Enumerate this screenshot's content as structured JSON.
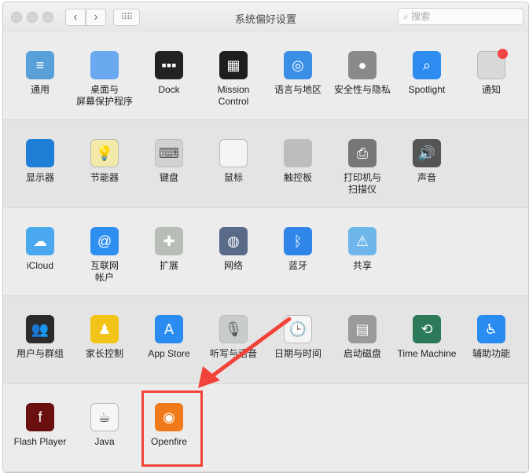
{
  "window": {
    "title": "系统偏好设置",
    "search_placeholder": "搜索",
    "back_icon": "chevron-left-icon",
    "forward_icon": "chevron-right-icon",
    "grid_icon": "show-all-grid-icon"
  },
  "rows": [
    [
      {
        "id": "general",
        "label": "通用",
        "icon": "general-icon",
        "color": "#5aa0d8",
        "glyph": "≡"
      },
      {
        "id": "desktop",
        "label": "桌面与\n屏幕保护程序",
        "icon": "desktop-icon",
        "color": "#6aa8f0",
        "glyph": ""
      },
      {
        "id": "dock",
        "label": "Dock",
        "icon": "dock-icon",
        "color": "#222222",
        "glyph": "▪▪▪"
      },
      {
        "id": "mission-control",
        "label": "Mission\nControl",
        "icon": "mission-control-icon",
        "color": "#1e1e1e",
        "glyph": "▦"
      },
      {
        "id": "language",
        "label": "语言与地区",
        "icon": "un-flag-icon",
        "color": "#3a8ee6",
        "glyph": "◎"
      },
      {
        "id": "security",
        "label": "安全性与隐私",
        "icon": "security-house-icon",
        "color": "#8a8a8a",
        "glyph": "●"
      },
      {
        "id": "spotlight",
        "label": "Spotlight",
        "icon": "spotlight-icon",
        "color": "#2e8cf0",
        "glyph": "⌕"
      },
      {
        "id": "notifications",
        "label": "通知",
        "icon": "notifications-icon",
        "color": "#d8d8d8",
        "glyph": ""
      }
    ],
    [
      {
        "id": "displays",
        "label": "显示器",
        "icon": "display-icon",
        "color": "#1f7fd6",
        "glyph": ""
      },
      {
        "id": "energy",
        "label": "节能器",
        "icon": "lightbulb-icon",
        "color": "#f3e9a8",
        "glyph": "💡"
      },
      {
        "id": "keyboard",
        "label": "键盘",
        "icon": "keyboard-icon",
        "color": "#d2d2d2",
        "glyph": "⌨"
      },
      {
        "id": "mouse",
        "label": "鼠标",
        "icon": "mouse-icon",
        "color": "#f4f4f4",
        "glyph": ""
      },
      {
        "id": "trackpad",
        "label": "触控板",
        "icon": "trackpad-icon",
        "color": "#bdbdbd",
        "glyph": ""
      },
      {
        "id": "printers",
        "label": "打印机与\n扫描仪",
        "icon": "printer-icon",
        "color": "#777777",
        "glyph": "⎙"
      },
      {
        "id": "sound",
        "label": "声音",
        "icon": "speaker-icon",
        "color": "#555555",
        "glyph": "🔊"
      }
    ],
    [
      {
        "id": "icloud",
        "label": "iCloud",
        "icon": "icloud-icon",
        "color": "#4aa8ef",
        "glyph": "☁"
      },
      {
        "id": "internet-accounts",
        "label": "互联网\n帐户",
        "icon": "at-sign-icon",
        "color": "#2f8ff0",
        "glyph": "@"
      },
      {
        "id": "extensions",
        "label": "扩展",
        "icon": "puzzle-icon",
        "color": "#b8bdb8",
        "glyph": "✚"
      },
      {
        "id": "network",
        "label": "网络",
        "icon": "network-globe-icon",
        "color": "#5a6b8a",
        "glyph": "◍"
      },
      {
        "id": "bluetooth",
        "label": "蓝牙",
        "icon": "bluetooth-icon",
        "color": "#2f86e8",
        "glyph": "ᛒ"
      },
      {
        "id": "sharing",
        "label": "共享",
        "icon": "sharing-folder-icon",
        "color": "#6fb6ea",
        "glyph": "⚠"
      }
    ],
    [
      {
        "id": "users",
        "label": "用户与群组",
        "icon": "users-icon",
        "color": "#2b2b2b",
        "glyph": "👥"
      },
      {
        "id": "parental",
        "label": "家长控制",
        "icon": "parental-controls-icon",
        "color": "#f2c417",
        "glyph": "♟"
      },
      {
        "id": "app-store",
        "label": "App Store",
        "icon": "app-store-icon",
        "color": "#2a8cf0",
        "glyph": "A"
      },
      {
        "id": "dictation",
        "label": "听写与语音",
        "icon": "microphone-icon",
        "color": "#c8cccc",
        "glyph": "🎙"
      },
      {
        "id": "date-time",
        "label": "日期与时间",
        "icon": "clock-calendar-icon",
        "color": "#f4f4f4",
        "glyph": "🕒"
      },
      {
        "id": "startup-disk",
        "label": "启动磁盘",
        "icon": "hard-drive-icon",
        "color": "#9a9a9a",
        "glyph": "▤"
      },
      {
        "id": "time-machine",
        "label": "Time Machine",
        "icon": "time-machine-icon",
        "color": "#2d7a5a",
        "glyph": "⟲"
      },
      {
        "id": "accessibility",
        "label": "辅助功能",
        "icon": "accessibility-icon",
        "color": "#2a8cf0",
        "glyph": "♿"
      }
    ],
    [
      {
        "id": "flash",
        "label": "Flash Player",
        "icon": "flash-player-icon",
        "color": "#6a1010",
        "glyph": "f"
      },
      {
        "id": "java",
        "label": "Java",
        "icon": "java-icon",
        "color": "#f6f6f6",
        "glyph": "☕"
      },
      {
        "id": "openfire",
        "label": "Openfire",
        "icon": "openfire-icon",
        "color": "#f07a1a",
        "glyph": "◉"
      }
    ]
  ],
  "annotation_color": "#f2433a"
}
